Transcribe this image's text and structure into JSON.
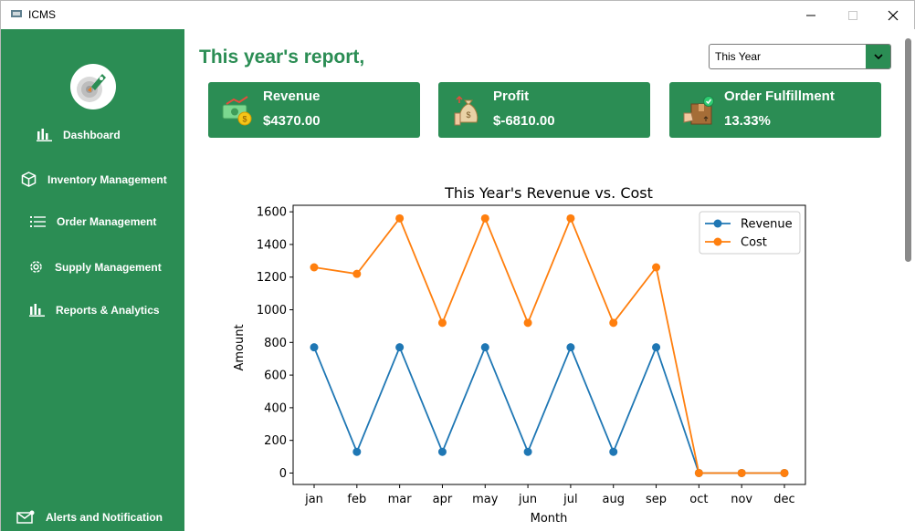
{
  "window": {
    "title": "ICMS"
  },
  "sidebar": {
    "items": [
      {
        "label": "Dashboard",
        "icon": "bar-chart-icon"
      },
      {
        "label": "Inventory Management",
        "icon": "box-icon"
      },
      {
        "label": "Order Management",
        "icon": "list-icon"
      },
      {
        "label": "Supply Management",
        "icon": "gear-icon"
      },
      {
        "label": "Reports & Analytics",
        "icon": "bar-chart-icon"
      },
      {
        "label": "Alerts and Notification",
        "icon": "mail-icon"
      }
    ]
  },
  "main": {
    "heading": "This year's report,",
    "period_select": {
      "value": "This Year"
    },
    "cards": [
      {
        "label": "Revenue",
        "value": "$4370.00",
        "icon": "money-icon"
      },
      {
        "label": "Profit",
        "value": "$-6810.00",
        "icon": "money-bag-icon"
      },
      {
        "label": "Order Fulfillment",
        "value": "13.33%",
        "icon": "package-icon"
      }
    ]
  },
  "colors": {
    "brand_green": "#2b8d54",
    "revenue_line": "#1f77b4",
    "cost_line": "#ff7f0e"
  },
  "chart_data": {
    "type": "line",
    "title": "This Year's Revenue vs. Cost",
    "xlabel": "Month",
    "ylabel": "Amount",
    "categories": [
      "jan",
      "feb",
      "mar",
      "apr",
      "may",
      "jun",
      "jul",
      "aug",
      "sep",
      "oct",
      "nov",
      "dec"
    ],
    "ylim": [
      -70,
      1640
    ],
    "yticks": [
      0,
      200,
      400,
      600,
      800,
      1000,
      1200,
      1400,
      1600
    ],
    "legend": "top-right",
    "grid": false,
    "series": [
      {
        "name": "Revenue",
        "color": "#1f77b4",
        "values": [
          770,
          130,
          770,
          130,
          770,
          130,
          770,
          130,
          770,
          0,
          0,
          0
        ]
      },
      {
        "name": "Cost",
        "color": "#ff7f0e",
        "values": [
          1260,
          1220,
          1560,
          920,
          1560,
          920,
          1560,
          920,
          1260,
          0,
          0,
          0
        ]
      }
    ]
  }
}
